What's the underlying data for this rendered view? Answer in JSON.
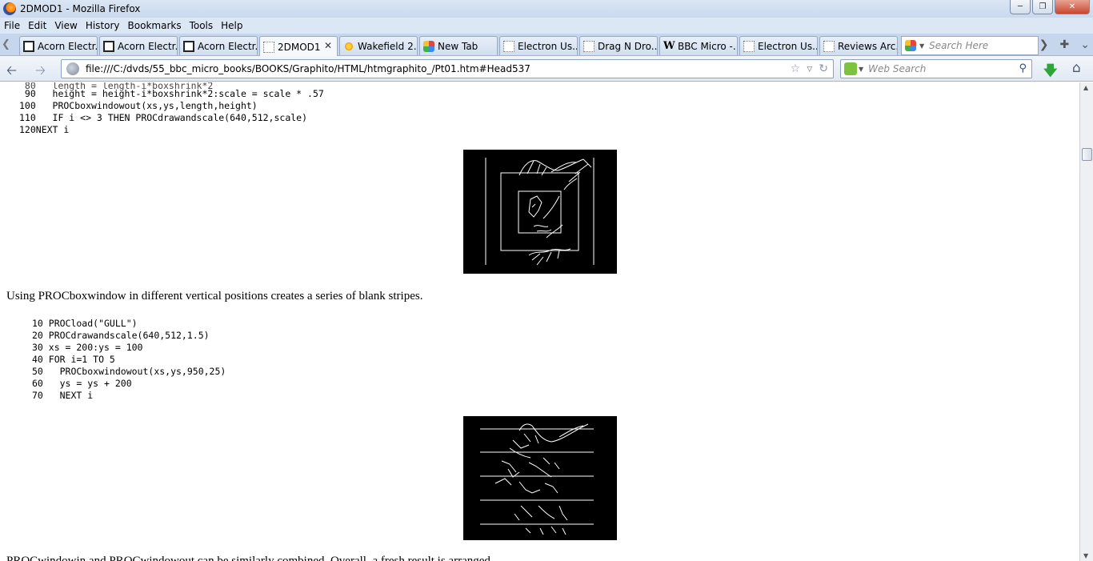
{
  "window": {
    "title": "2DMOD1 - Mozilla Firefox",
    "controls": [
      "minimize",
      "maximize",
      "close"
    ]
  },
  "menu": {
    "items": [
      "File",
      "Edit",
      "View",
      "History",
      "Bookmarks",
      "Tools",
      "Help"
    ]
  },
  "tabs": [
    {
      "label": "Acorn Electr...",
      "icon": "acorn-icon"
    },
    {
      "label": "Acorn Electr...",
      "icon": "acorn-icon"
    },
    {
      "label": "Acorn Electr...",
      "icon": "acorn-icon"
    },
    {
      "label": "2DMOD1",
      "icon": "blank-page-icon",
      "active": true
    },
    {
      "label": "Wakefield 2...",
      "icon": "sun-icon"
    },
    {
      "label": "New Tab",
      "icon": "multicolor-icon"
    },
    {
      "label": "Electron Us...",
      "icon": "blank-page-icon"
    },
    {
      "label": "Drag N Dro...",
      "icon": "blank-page-icon"
    },
    {
      "label": "BBC Micro -...",
      "icon": "wikipedia-icon"
    },
    {
      "label": "Electron Us...",
      "icon": "blank-page-icon"
    },
    {
      "label": "Reviews Arc...",
      "icon": "blank-page-icon"
    }
  ],
  "tab_search": {
    "placeholder": "Search Here"
  },
  "nav": {
    "url": "file:///C:/dvds/55_bbc_micro_books/BOOKS/Graphito/HTML/htmgraphito_/Pt01.htm#Head537",
    "web_search_placeholder": "Web Search"
  },
  "page": {
    "code1": [
      " 90   height = height-i*boxshrink*2:scale = scale * .57",
      "100   PROCboxwindowout(xs,ys,length,height)",
      "110   IF i <> 3 THEN PROCdrawandscale(640,512,scale)",
      "120NEXT i"
    ],
    "para1": "Using PROCboxwindow in different vertical positions creates a series of blank stripes.",
    "code2": [
      "10 PROCload(\"GULL\")",
      "20 PROCdrawandscale(640,512,1.5)",
      "30 xs = 200:ys = 100",
      "40 FOR i=1 TO 5",
      "50   PROCboxwindowout(xs,ys,950,25)",
      "60   ys = ys + 200",
      "70   NEXT i"
    ]
  },
  "colors": {
    "chrome": "#dce7f5",
    "figure_bg": "#000000",
    "figure_lines": "#ffffff"
  }
}
